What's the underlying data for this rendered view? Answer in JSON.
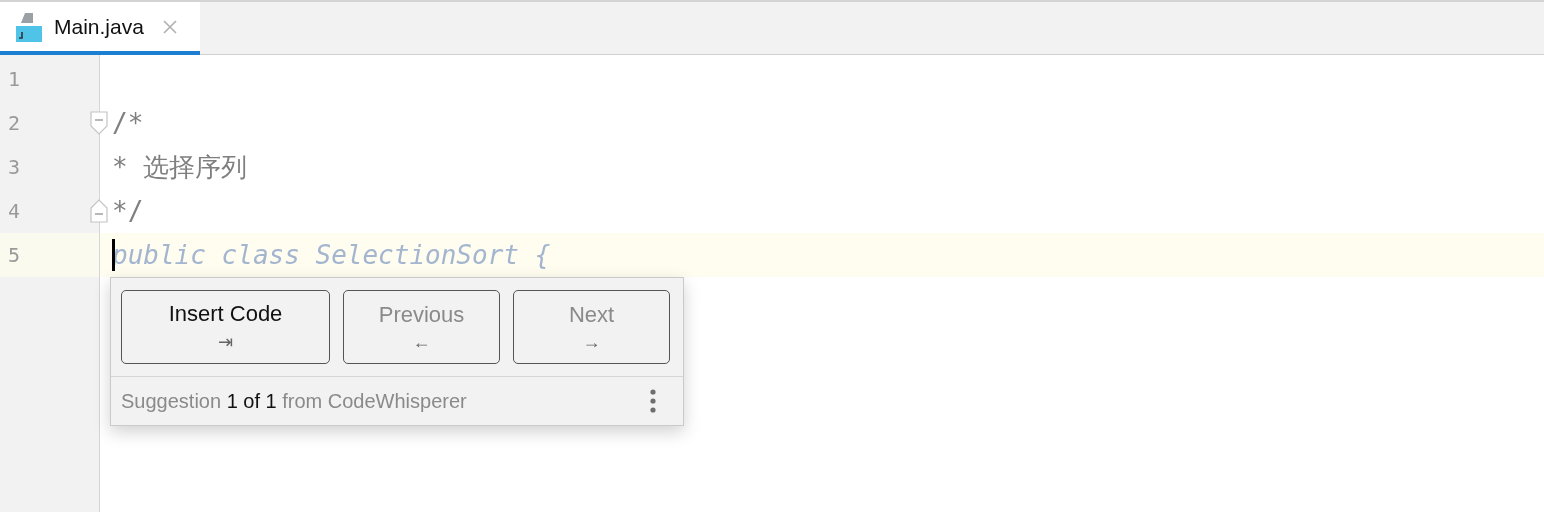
{
  "tabs": [
    {
      "label": "Main.java",
      "selected": true
    }
  ],
  "lines": [
    {
      "number": "1",
      "fold_start": false,
      "fold_end": false,
      "current": false
    },
    {
      "number": "2",
      "text": "/*",
      "kind": "comment",
      "fold_start": true,
      "fold_end": false,
      "current": false
    },
    {
      "number": "3",
      "text": "* 选择序列",
      "kind": "comment",
      "fold_start": false,
      "fold_end": false,
      "current": false
    },
    {
      "number": "4",
      "text": "*/",
      "kind": "comment",
      "fold_start": false,
      "fold_end": true,
      "current": false
    },
    {
      "number": "5",
      "text": "public class SelectionSort {",
      "kind": "suggestion",
      "fold_start": false,
      "fold_end": false,
      "current": true
    }
  ],
  "popup": {
    "buttons": [
      {
        "label": "Insert Code",
        "key": "⇥",
        "disabled": false
      },
      {
        "label": "Previous",
        "key": "←",
        "disabled": true
      },
      {
        "label": "Next",
        "key": "→",
        "disabled": true
      }
    ],
    "status": "Suggestion **1 of 1** from CodeWhisperer"
  }
}
